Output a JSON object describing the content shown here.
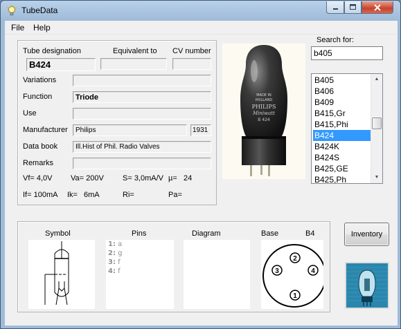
{
  "window": {
    "title": "TubeData"
  },
  "menu": {
    "file": "File",
    "help": "Help"
  },
  "labels": {
    "tube_designation": "Tube designation",
    "equivalent_to": "Equivalent to",
    "cv_number": "CV number",
    "variations": "Variations",
    "function": "Function",
    "use": "Use",
    "manufacturer": "Manufacturer",
    "data_book": "Data book",
    "remarks": "Remarks"
  },
  "tube": {
    "designation": "B424",
    "equivalent_to": "",
    "cv_number": "",
    "variations": "",
    "function": "Triode",
    "use": "",
    "manufacturer": "Philips",
    "year": "1931",
    "data_book": "Ill.Hist of Phil. Radio Valves",
    "remarks": ""
  },
  "params": {
    "vf": "Vf= 4,0V",
    "va": "Va= 200V",
    "s": "S= 3,0mA/V",
    "mu": "µ=",
    "mu_value": "24",
    "if": "If= 100mA",
    "ik": "Ik=",
    "ik_value": "6mA",
    "ri": "Ri=",
    "pa": "Pa="
  },
  "photo": {
    "line1": "MADE IN",
    "line2": "HOLLAND",
    "line3": "PHILIPS",
    "line4": "Miniwatt",
    "line5": "B 424"
  },
  "search": {
    "label": "Search for:",
    "value": "b405"
  },
  "list": {
    "items": [
      "B405",
      "B406",
      "B409",
      "B415,Gr",
      "B415,Phi",
      "B424",
      "B424K",
      "B424S",
      "B425,GE",
      "B425,Ph"
    ],
    "selected": "B424"
  },
  "bottom": {
    "symbol_label": "Symbol",
    "pins_label": "Pins",
    "diagram_label": "Diagram",
    "base_label": "Base",
    "base_value": "B4",
    "pins": [
      {
        "num": "1:",
        "name": "a"
      },
      {
        "num": "2:",
        "name": "g"
      },
      {
        "num": "3:",
        "name": "f"
      },
      {
        "num": "4:",
        "name": "f"
      }
    ],
    "base_pins": [
      "1",
      "2",
      "3",
      "4"
    ]
  },
  "buttons": {
    "inventory": "Inventory"
  },
  "icons": [
    "lightbulb-icon",
    "minimize-icon",
    "maximize-icon",
    "close-icon",
    "scroll-up-icon",
    "scroll-down-icon",
    "tubedata-logo-icon"
  ]
}
